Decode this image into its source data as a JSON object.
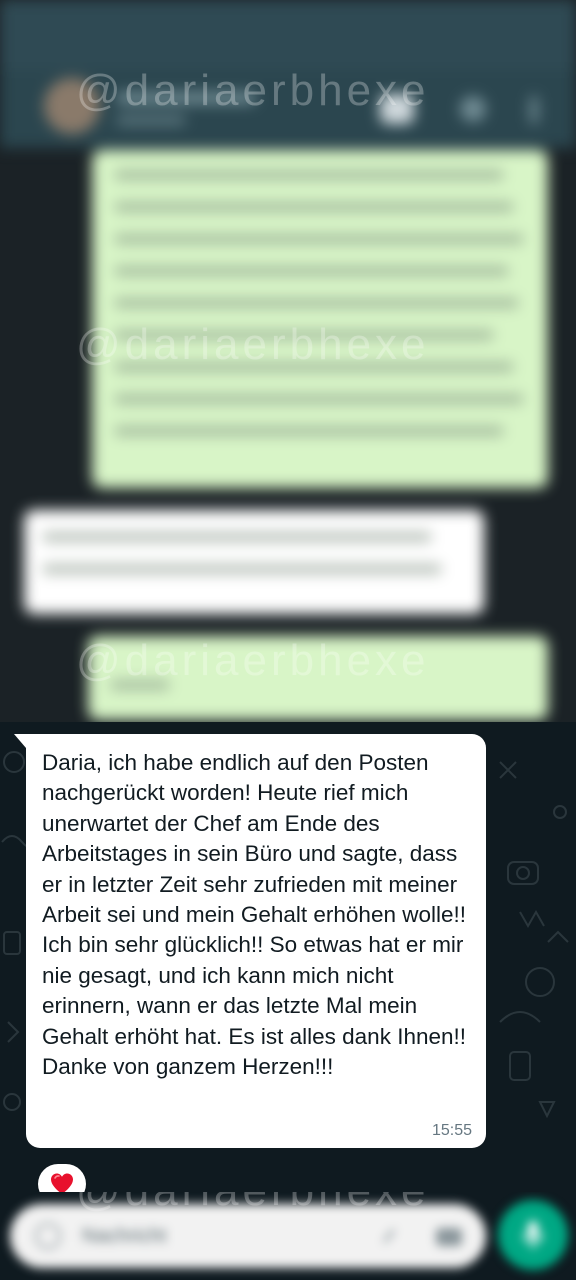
{
  "watermark": "@dariaerbhexe",
  "message": {
    "text": "Daria, ich habe endlich auf den Posten nachgerückt worden! Heute rief mich unerwartet der Chef am Ende des Arbeitstages in sein Büro und sagte, dass er in letzter Zeit sehr zufrieden mit meiner Arbeit sei und mein Gehalt erhöhen wolle!! Ich bin sehr glücklich!! So etwas hat er mir nie gesagt, und ich kann mich nicht erinnern, wann er das letzte Mal mein Gehalt erhöht hat. Es ist alles dank Ihnen!! Danke von ganzem Herzen!!!",
    "time": "15:55",
    "reaction_icon": "heart"
  },
  "input": {
    "placeholder": "Nachricht"
  },
  "colors": {
    "background": "#0b141a",
    "incoming_bubble": "#ffffff",
    "outgoing_bubble": "#d9fdd3",
    "accent": "#00a884",
    "reaction": "#e8112d"
  }
}
